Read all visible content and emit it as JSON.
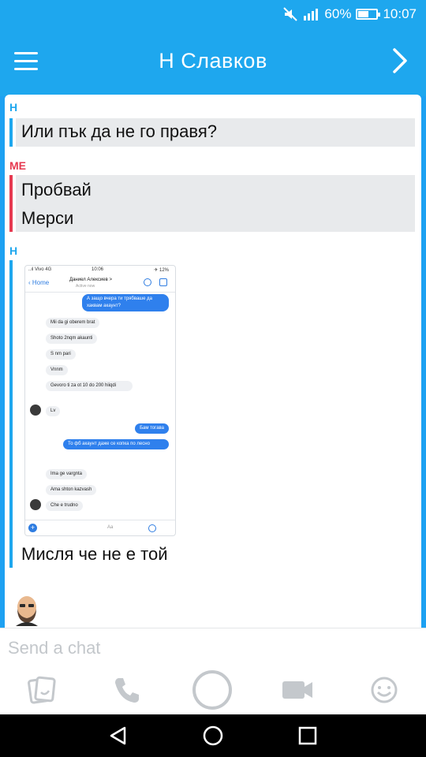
{
  "status_bar": {
    "battery": "60%",
    "time": "10:07",
    "battery_level": 0.6
  },
  "header": {
    "title": "Н Славков",
    "menu_icon": "hamburger-icon",
    "forward_icon": "chevron-right-icon"
  },
  "chat": {
    "blocks": [
      {
        "sender": "Н",
        "messages": [
          "Или пък да не го правя?"
        ]
      },
      {
        "sender": "ME",
        "messages": [
          "Пробвай",
          "Мерси"
        ]
      },
      {
        "sender": "Н",
        "caption": "Мисля че не е той"
      }
    ],
    "embedded_screenshot": {
      "status_left": "..ıl Vivo 4G",
      "status_time": "10:06",
      "status_right": "✈ 12%",
      "back_label": "Home",
      "contact_name": "Даниел Алексиев >",
      "contact_status": "Active now",
      "messages": [
        {
          "side": "out",
          "text": "А защо вчера ти трябваше да хаквам акаунт?"
        },
        {
          "side": "in",
          "text": "Mii da gi oberem brat"
        },
        {
          "side": "in",
          "text": "Shoto 2nqm akaunti"
        },
        {
          "side": "in",
          "text": "S nm pari"
        },
        {
          "side": "in",
          "text": "Vnnm"
        },
        {
          "side": "in",
          "text": "Gevoro ti za ot 10 do 200 hiiqdi"
        },
        {
          "side": "in",
          "text": "Lv"
        },
        {
          "side": "out",
          "text": "Бам тогава"
        },
        {
          "side": "out",
          "text": "То фб акаунт даже се копка по лесно"
        },
        {
          "side": "in",
          "text": "Ima ge vargnta"
        },
        {
          "side": "in",
          "text": "Ama shton kazvash"
        },
        {
          "side": "in",
          "text": "Che e trudno"
        }
      ],
      "compose_placeholder": "Aa"
    }
  },
  "input": {
    "placeholder": "Send a chat"
  },
  "toolbar": {
    "icons": [
      "stickers-icon",
      "phone-icon",
      "capture-icon",
      "video-icon",
      "emoji-icon"
    ]
  },
  "nav": {
    "icons": [
      "back-icon",
      "home-icon",
      "recents-icon"
    ]
  },
  "colors": {
    "accent": "#1ea7ee",
    "me_color": "#e63950"
  }
}
